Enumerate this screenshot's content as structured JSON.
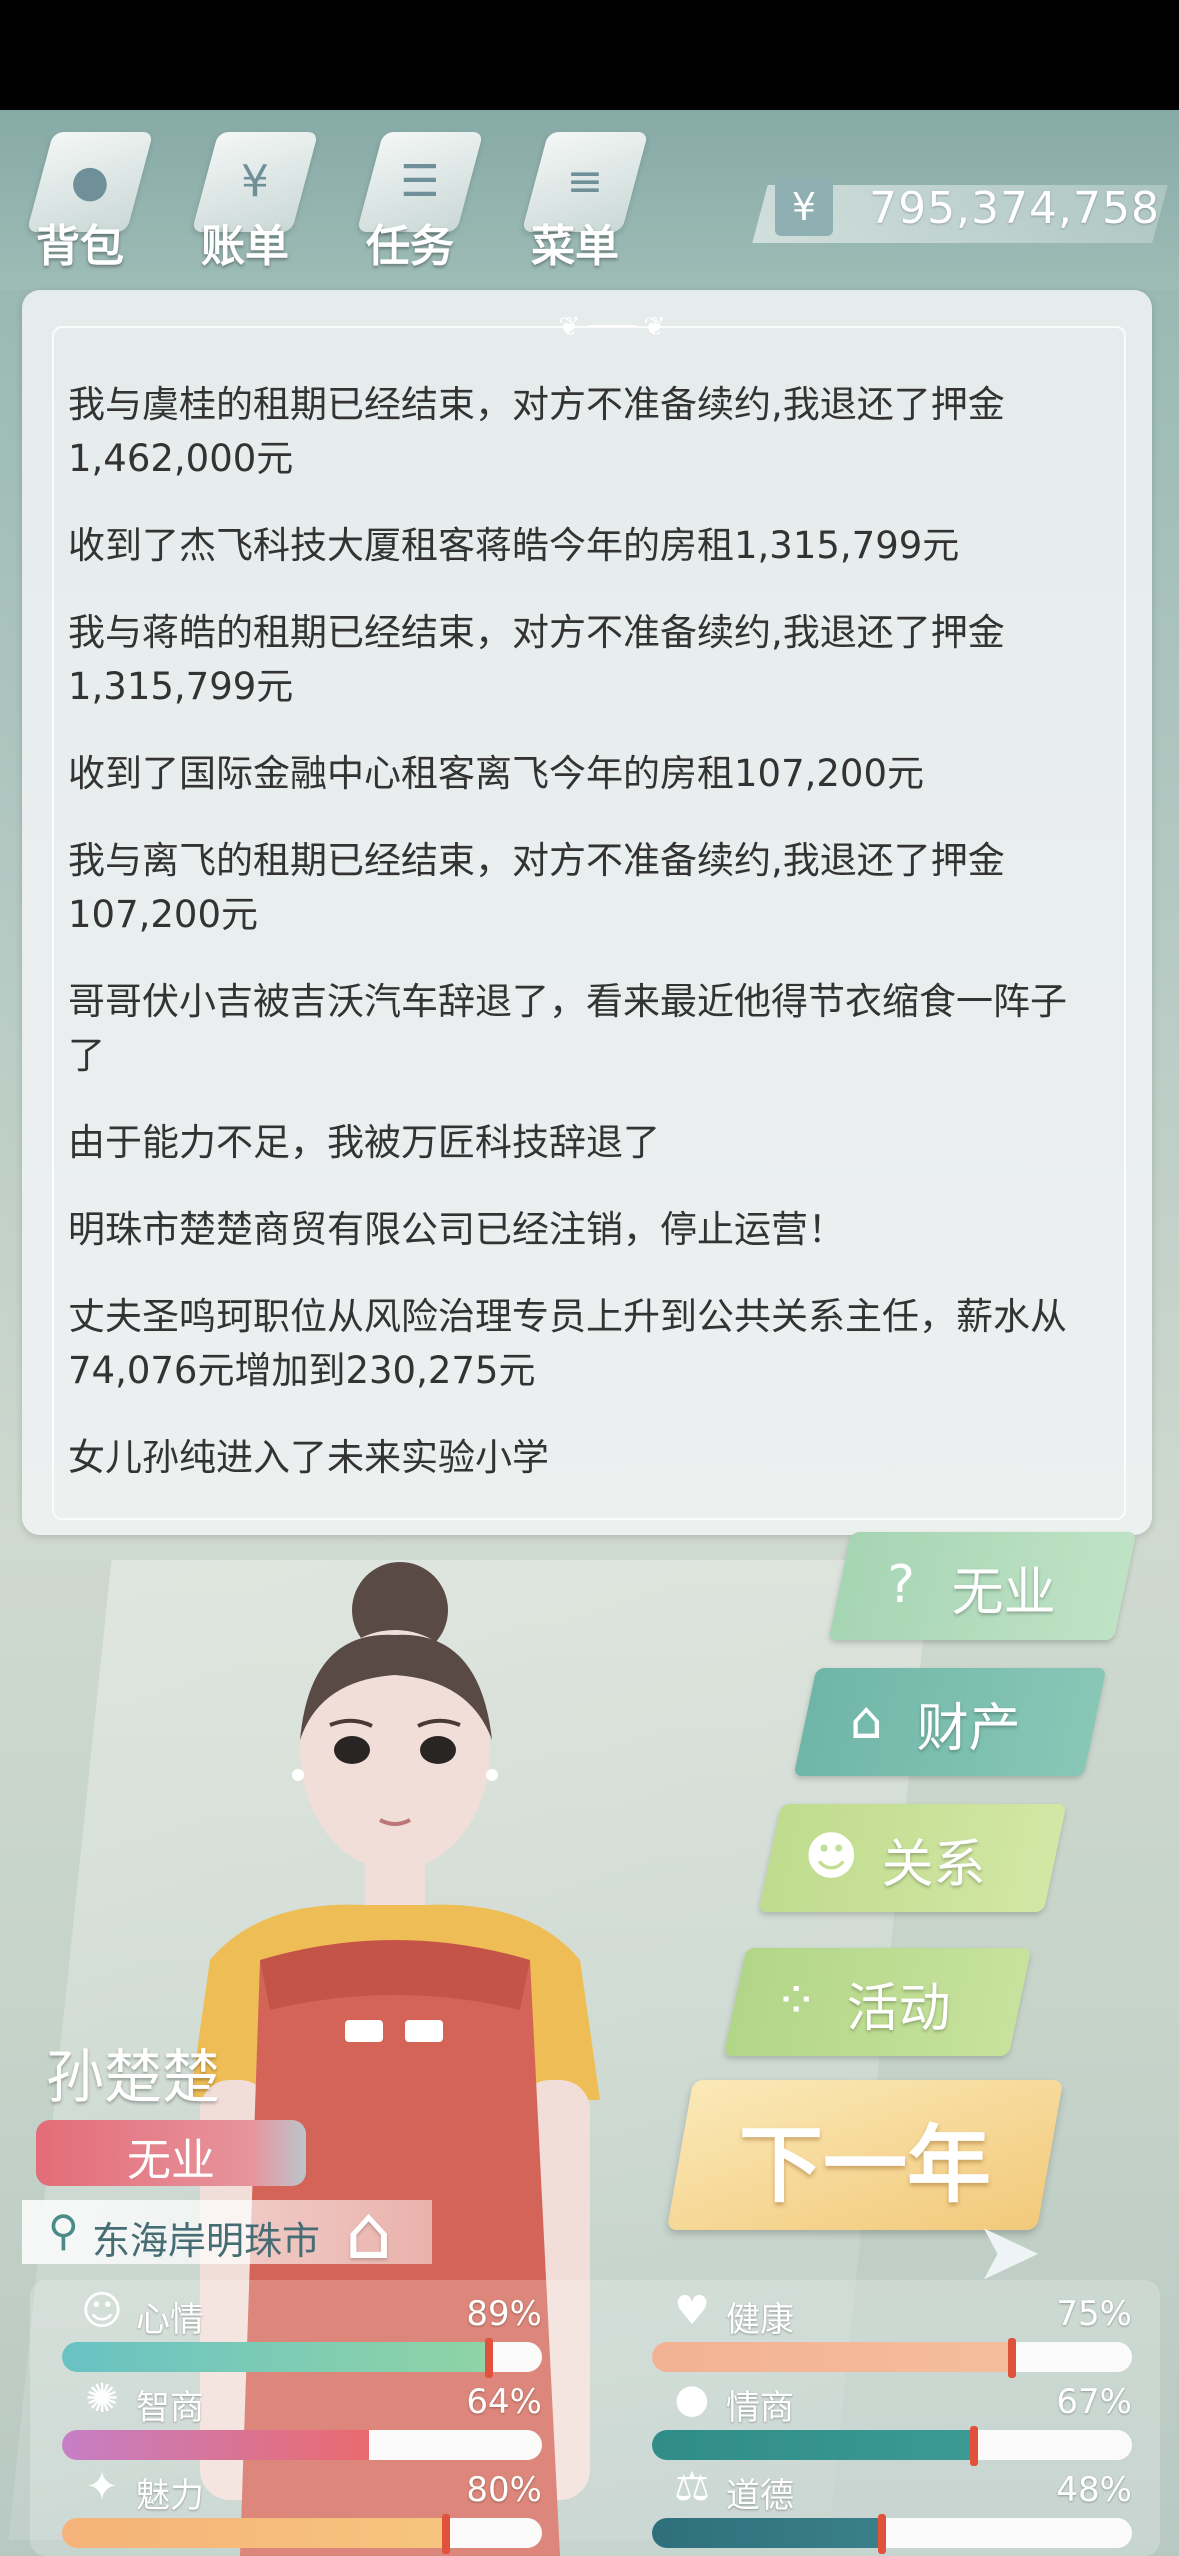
{
  "nav": [
    {
      "label": "背包",
      "icon": "bag-icon"
    },
    {
      "label": "账单",
      "icon": "bill-icon"
    },
    {
      "label": "任务",
      "icon": "task-icon"
    },
    {
      "label": "菜单",
      "icon": "menu-icon"
    }
  ],
  "money": {
    "symbol": "¥",
    "value": "795,374,758"
  },
  "log": [
    "我与虞桂的租期已经结束，对方不准备续约,我退还了押金1,462,000元",
    "收到了杰飞科技大厦租客蒋皓今年的房租1,315,799元",
    "我与蒋皓的租期已经结束，对方不准备续约,我退还了押金1,315,799元",
    "收到了国际金融中心租客离飞今年的房租107,200元",
    "我与离飞的租期已经结束，对方不准备续约,我退还了押金107,200元",
    "哥哥伏小吉被吉沃汽车辞退了，看来最近他得节衣缩食一阵子了",
    "由于能力不足，我被万匠科技辞退了",
    "明珠市楚楚商贸有限公司已经注销，停止运营！",
    "丈夫圣鸣珂职位从风险治理专员上升到公共关系主任，薪水从74,076元增加到230,275元",
    "女儿孙纯进入了未来实验小学"
  ],
  "side_buttons": [
    {
      "label": "无业",
      "icon": "question-icon",
      "color": "#a6d5b4"
    },
    {
      "label": "财产",
      "icon": "house-icon",
      "color": "#7fbfb1"
    },
    {
      "label": "关系",
      "icon": "people-icon",
      "color": "#c4df96"
    },
    {
      "label": "活动",
      "icon": "activity-icon",
      "color": "#b7d98c"
    }
  ],
  "next_year": "下一年",
  "player": {
    "name": "孙楚楚",
    "status": "无业",
    "location": "东海岸明珠市"
  },
  "stats": [
    {
      "label": "心情",
      "value": "89%",
      "level": 0.89,
      "icon": "smile-icon",
      "colors": [
        "#69c2c3",
        "#8fd4a6"
      ]
    },
    {
      "label": "健康",
      "value": "75%",
      "level": 0.75,
      "icon": "heart-icon",
      "colors": [
        "#f2b294",
        "#f5bd9c"
      ]
    },
    {
      "label": "智商",
      "value": "64%",
      "level": 0.64,
      "icon": "bulb-icon",
      "colors": [
        "#c57fc6",
        "#e96a6e"
      ]
    },
    {
      "label": "情商",
      "value": "67%",
      "level": 0.67,
      "icon": "apple-icon",
      "colors": [
        "#2f8c86",
        "#3b9a93"
      ]
    },
    {
      "label": "魅力",
      "value": "80%",
      "level": 0.8,
      "icon": "star-icon",
      "colors": [
        "#f5b27a",
        "#f6c57c"
      ]
    },
    {
      "label": "道德",
      "value": "48%",
      "level": 0.48,
      "icon": "scale-icon",
      "colors": [
        "#2f6f7c",
        "#3a7f8a"
      ]
    }
  ]
}
